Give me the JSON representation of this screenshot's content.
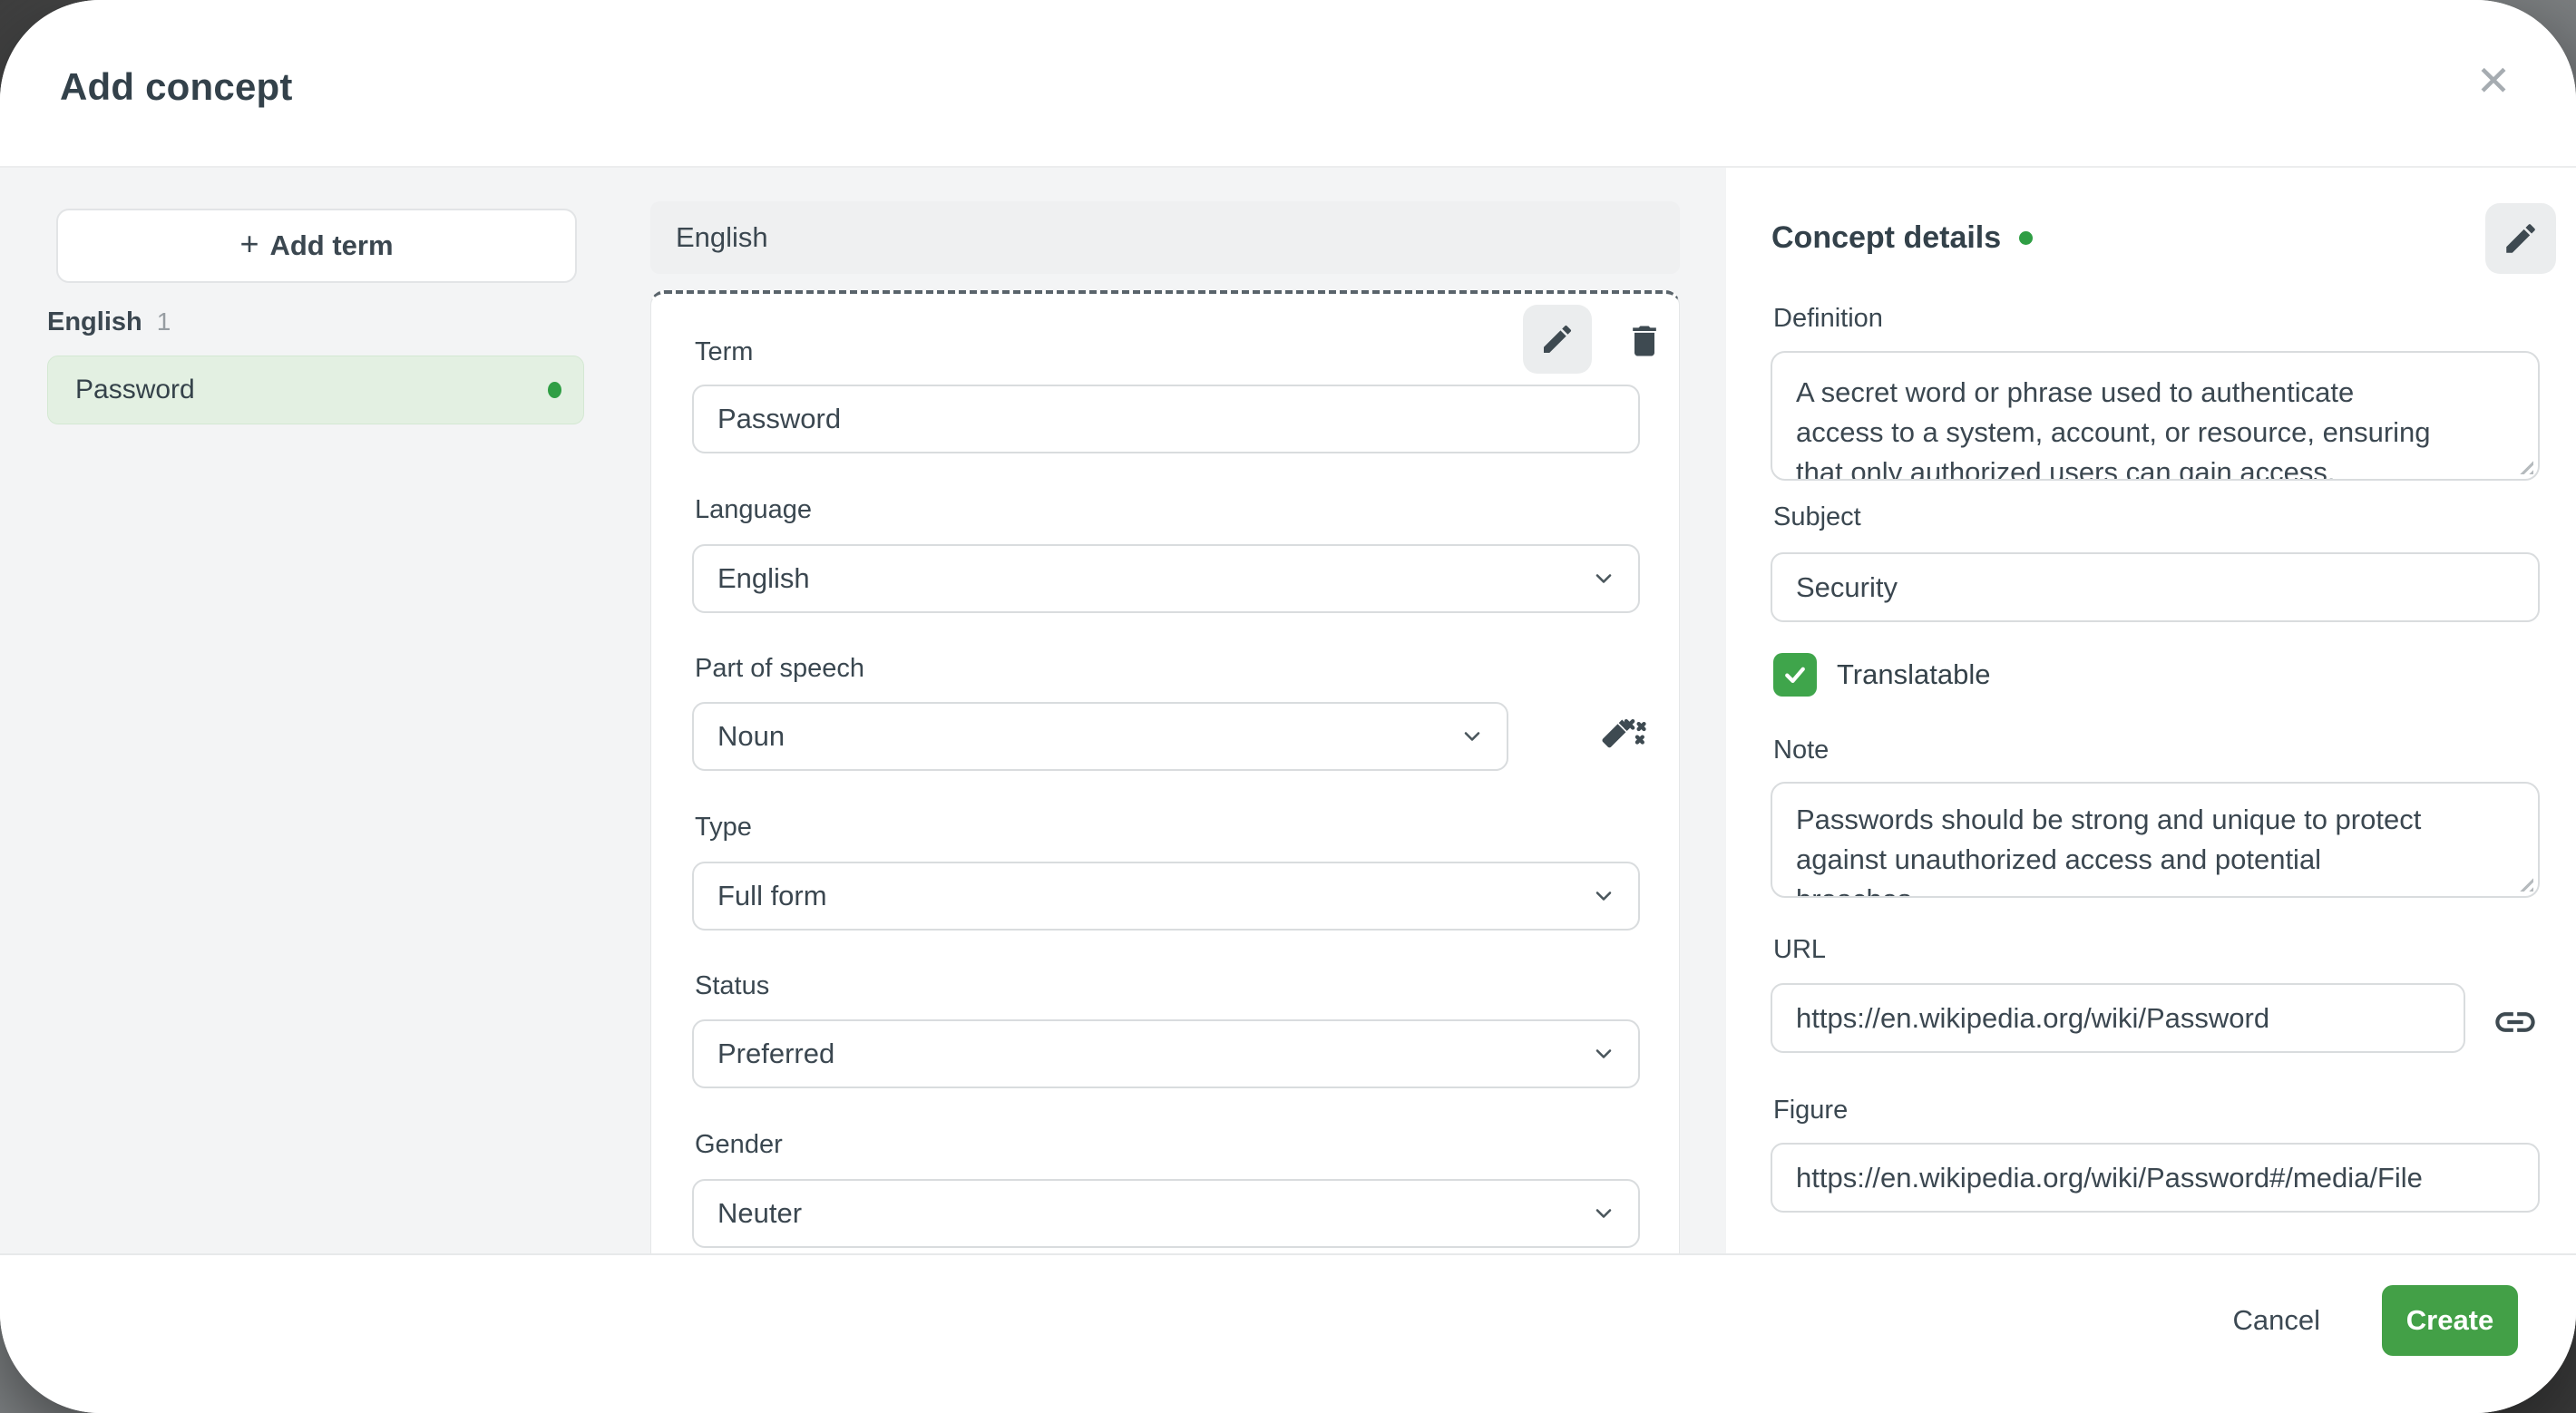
{
  "header": {
    "title": "Add concept"
  },
  "icons": {
    "plus": "+",
    "close": "✕"
  },
  "sidebar": {
    "add_term_label": "Add term",
    "group": {
      "label": "English",
      "count": "1"
    },
    "terms": [
      {
        "label": "Password"
      }
    ]
  },
  "term_panel": {
    "section_header": "English",
    "term_label": "Term",
    "term_value": "Password",
    "language_label": "Language",
    "language_value": "English",
    "pos_label": "Part of speech",
    "pos_value": "Noun",
    "type_label": "Type",
    "type_value": "Full form",
    "status_label": "Status",
    "status_value": "Preferred",
    "gender_label": "Gender",
    "gender_value": "Neuter"
  },
  "details_panel": {
    "title": "Concept details",
    "definition_label": "Definition",
    "definition_value": "A secret word or phrase used to authenticate\naccess to a system, account, or resource, ensuring\nthat only authorized users can gain access.",
    "subject_label": "Subject",
    "subject_value": "Security",
    "translatable_label": "Translatable",
    "translatable_checked": true,
    "note_label": "Note",
    "note_value": "Passwords should be strong and unique to protect\nagainst unauthorized access and potential\nbreaches.",
    "url_label": "URL",
    "url_value": "https://en.wikipedia.org/wiki/Password",
    "figure_label": "Figure",
    "figure_value": "https://en.wikipedia.org/wiki/Password#/media/File"
  },
  "footer": {
    "cancel_label": "Cancel",
    "create_label": "Create"
  },
  "colors": {
    "accent_green": "#43a047",
    "status_dot_green": "#2f9e44",
    "selected_term_bg": "#e3f0e2",
    "body_bg": "#f3f4f5"
  }
}
